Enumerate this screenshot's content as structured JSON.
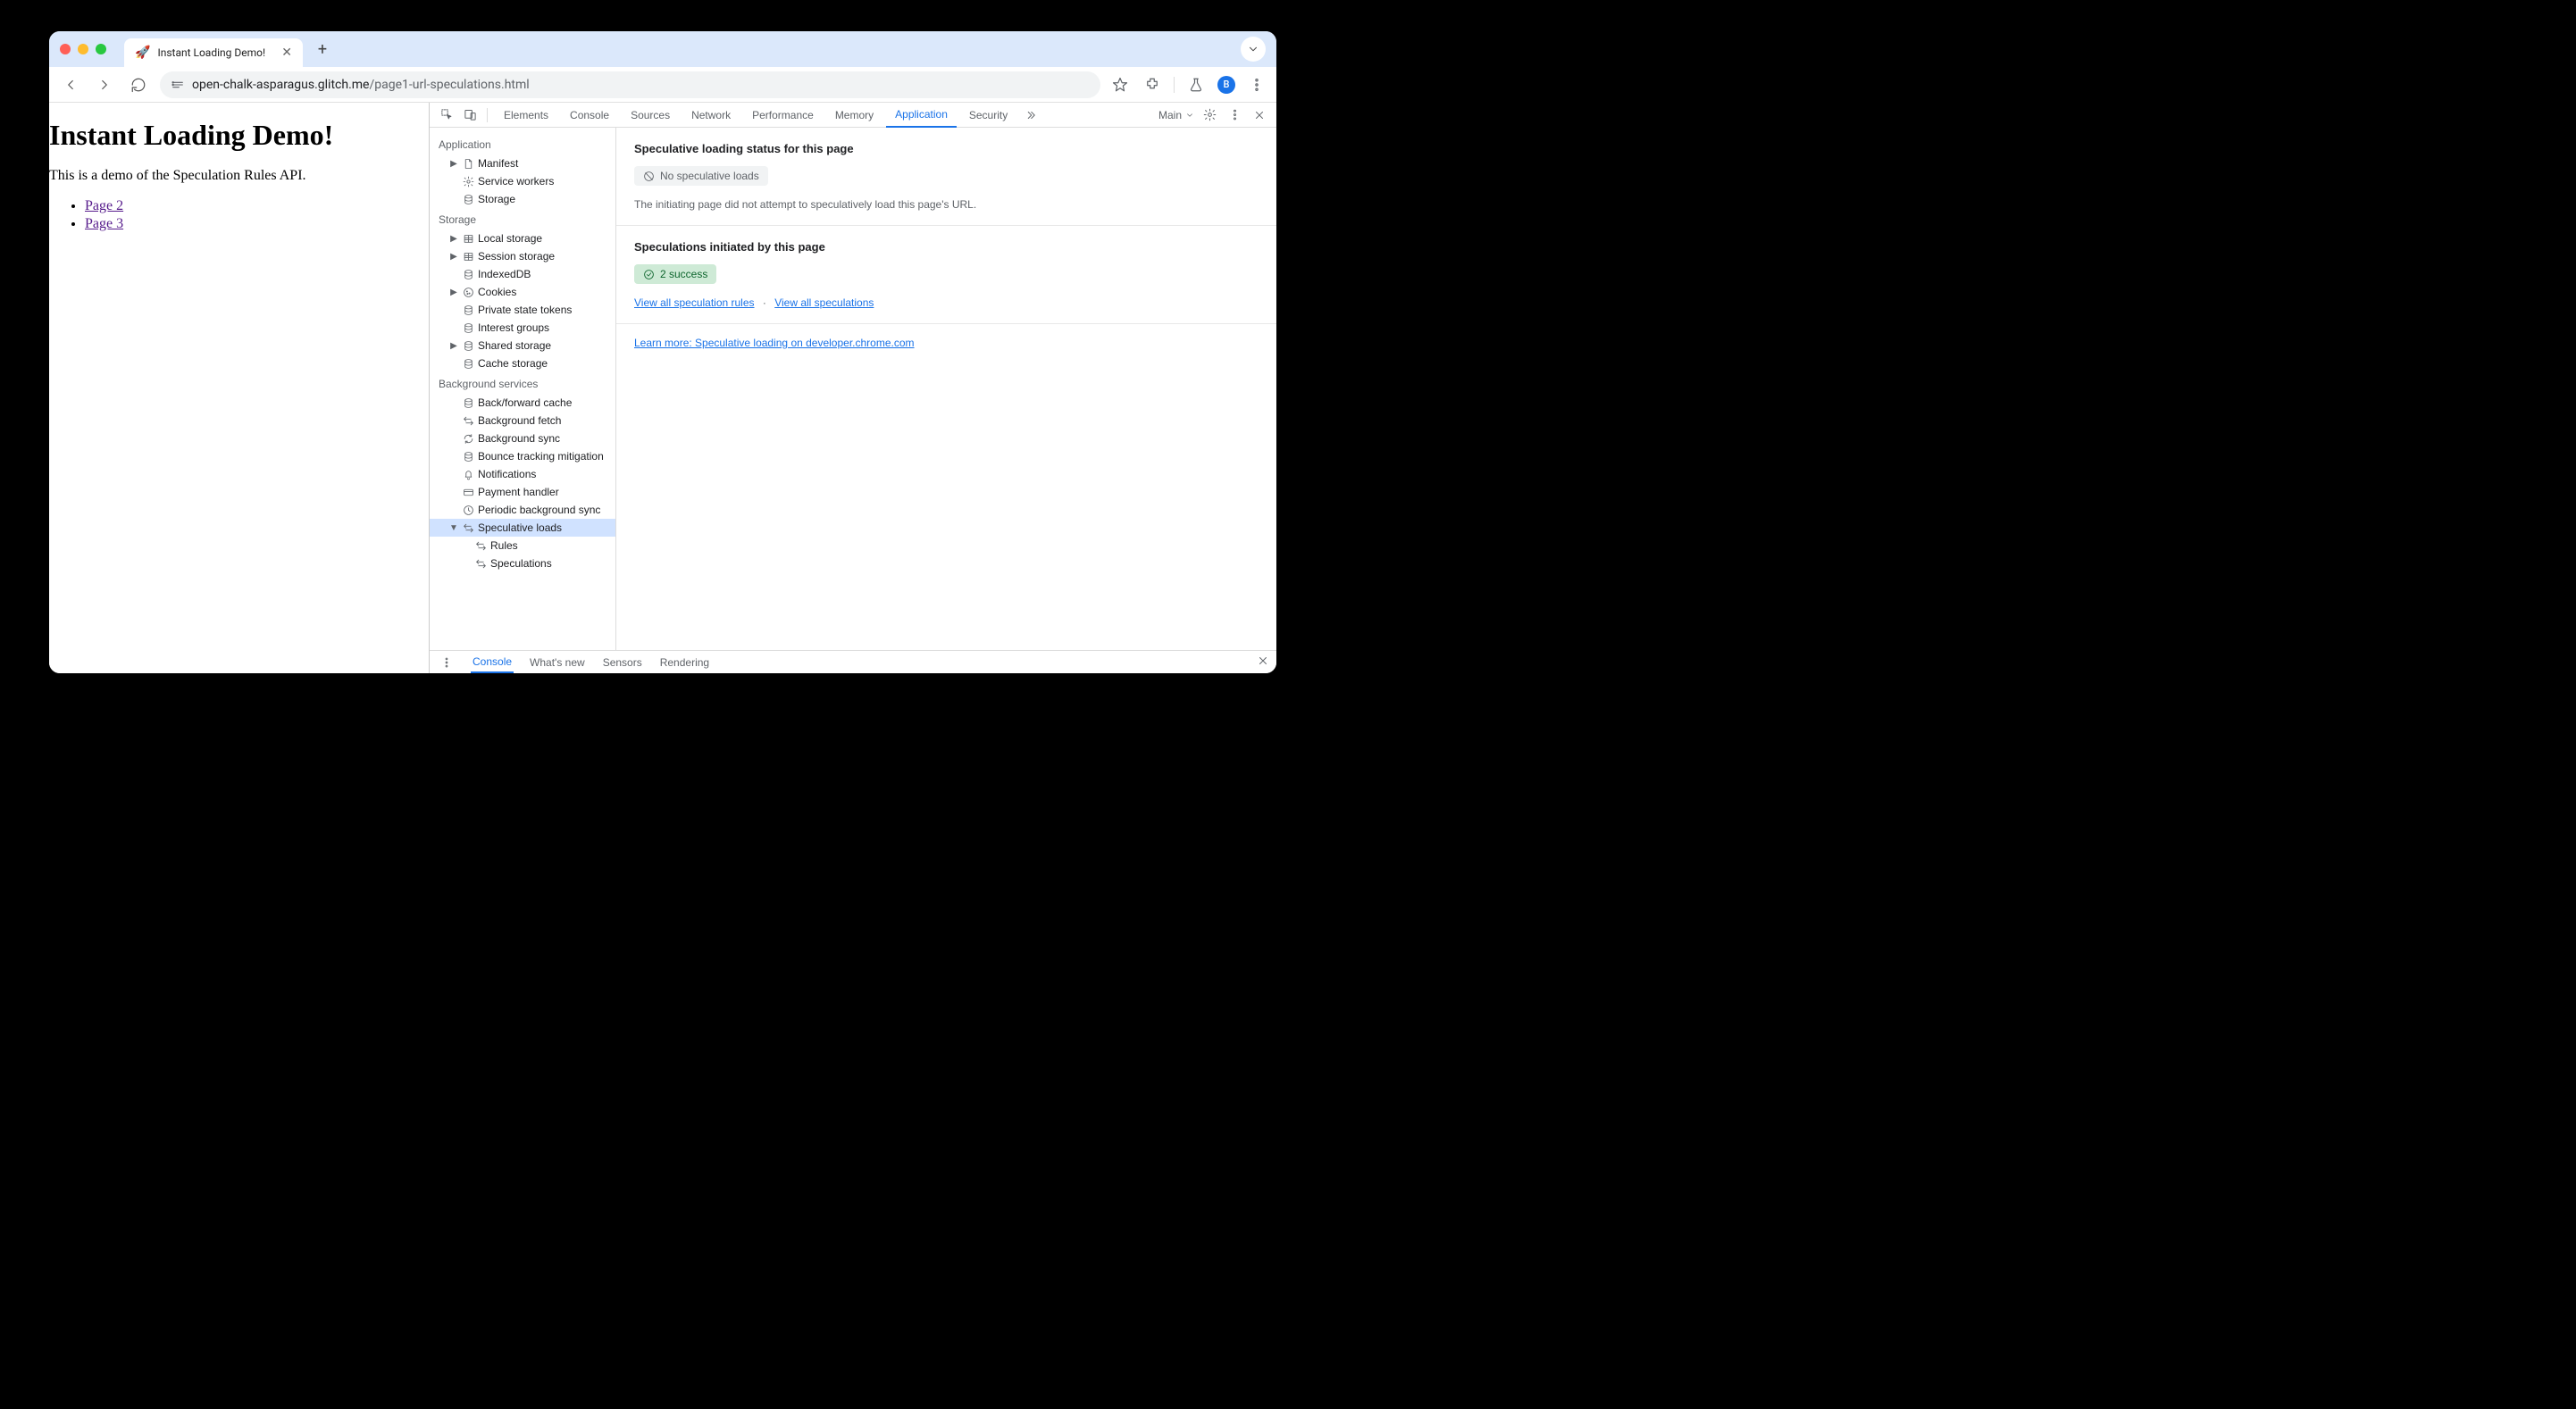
{
  "window": {
    "tab_favicon": "🚀",
    "tab_title": "Instant Loading Demo!",
    "url_host": "open-chalk-asparagus.glitch.me",
    "url_path": "/page1-url-speculations.html",
    "avatar_letter": "B"
  },
  "page": {
    "heading": "Instant Loading Demo!",
    "intro": "This is a demo of the Speculation Rules API.",
    "links": [
      "Page 2",
      "Page 3"
    ]
  },
  "devtools": {
    "tabs": [
      "Elements",
      "Console",
      "Sources",
      "Network",
      "Performance",
      "Memory",
      "Application",
      "Security"
    ],
    "active_tab": "Application",
    "target_label": "Main",
    "sidebar": {
      "sections": [
        {
          "title": "Application",
          "items": [
            {
              "label": "Manifest",
              "icon": "file",
              "expandable": true
            },
            {
              "label": "Service workers",
              "icon": "gear"
            },
            {
              "label": "Storage",
              "icon": "db"
            }
          ]
        },
        {
          "title": "Storage",
          "items": [
            {
              "label": "Local storage",
              "icon": "table",
              "expandable": true
            },
            {
              "label": "Session storage",
              "icon": "table",
              "expandable": true
            },
            {
              "label": "IndexedDB",
              "icon": "db"
            },
            {
              "label": "Cookies",
              "icon": "cookie",
              "expandable": true
            },
            {
              "label": "Private state tokens",
              "icon": "db"
            },
            {
              "label": "Interest groups",
              "icon": "db"
            },
            {
              "label": "Shared storage",
              "icon": "db",
              "expandable": true
            },
            {
              "label": "Cache storage",
              "icon": "db"
            }
          ]
        },
        {
          "title": "Background services",
          "items": [
            {
              "label": "Back/forward cache",
              "icon": "db"
            },
            {
              "label": "Background fetch",
              "icon": "swap"
            },
            {
              "label": "Background sync",
              "icon": "sync"
            },
            {
              "label": "Bounce tracking mitigation",
              "icon": "db"
            },
            {
              "label": "Notifications",
              "icon": "bell"
            },
            {
              "label": "Payment handler",
              "icon": "card"
            },
            {
              "label": "Periodic background sync",
              "icon": "clock"
            },
            {
              "label": "Speculative loads",
              "icon": "swap",
              "expandable": true,
              "expanded": true,
              "selected": true
            },
            {
              "label": "Rules",
              "icon": "swap",
              "indent": 2
            },
            {
              "label": "Speculations",
              "icon": "swap",
              "indent": 2
            }
          ]
        }
      ]
    },
    "detail": {
      "status_title": "Speculative loading status for this page",
      "status_badge": "No speculative loads",
      "status_desc": "The initiating page did not attempt to speculatively load this page's URL.",
      "initiated_title": "Speculations initiated by this page",
      "initiated_badge": "2 success",
      "link_rules": "View all speculation rules",
      "link_specs": "View all speculations",
      "learn_more": "Learn more: Speculative loading on developer.chrome.com"
    },
    "drawer": {
      "tabs": [
        "Console",
        "What's new",
        "Sensors",
        "Rendering"
      ],
      "active": "Console"
    }
  }
}
